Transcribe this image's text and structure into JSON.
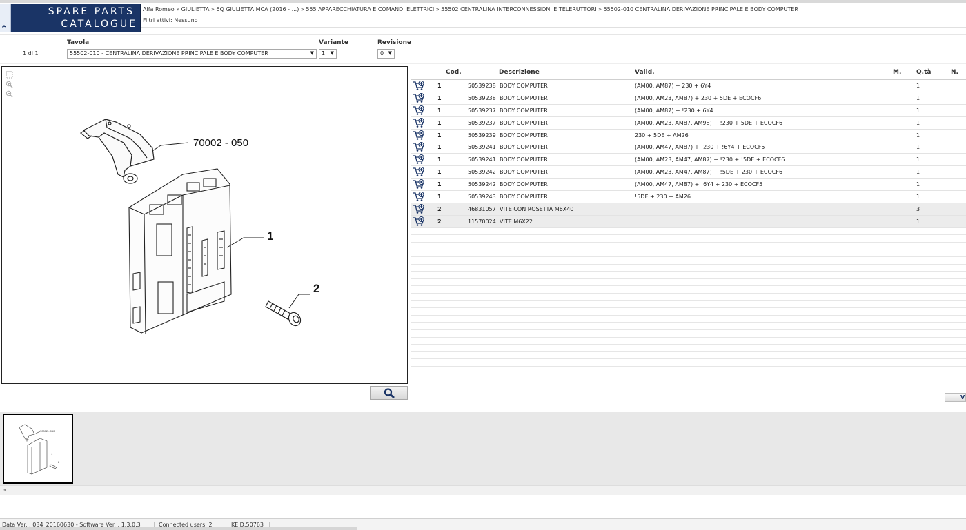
{
  "logo": {
    "badge": "e",
    "line1": "SPARE PARTS",
    "line2": "CATALOGUE"
  },
  "breadcrumb": "Alfa Romeo » GIULIETTA » 6Q GIULIETTA MCA (2016 - ...) » 555 APPARECCHIATURA E COMANDI ELETTRICI » 55502 CENTRALINA INTERCONNESSIONI E TELERUTTORI » 55502-010 CENTRALINA DERIVAZIONE PRINCIPALE E BODY COMPUTER",
  "filters": "Filtri attivi: Nessuno",
  "selectors": {
    "pager": "1 di 1",
    "tavola_label": "Tavola",
    "tavola_value": "55502-010 - CENTRALINA DERIVAZIONE PRINCIPALE E BODY COMPUTER",
    "variante_label": "Variante",
    "variante_value": "1",
    "revisione_label": "Revisione",
    "revisione_value": "0"
  },
  "drawing": {
    "callout_bracket": "70002 - 050",
    "callout_1": "1",
    "callout_2": "2",
    "tools": [
      "select-icon",
      "zoom-in-icon",
      "zoom-out-icon"
    ]
  },
  "table": {
    "headers": {
      "cod": "Cod.",
      "descrizione": "Descrizione",
      "valid": "Valid.",
      "m": "M.",
      "qta": "Q.tà",
      "n": "N."
    },
    "rows": [
      {
        "ref": "1",
        "cod": "50539238",
        "desc": "BODY COMPUTER",
        "valid": "(AM00, AM87) + 230 + 6Y4",
        "m": "",
        "qta": "1",
        "n": ""
      },
      {
        "ref": "1",
        "cod": "50539238",
        "desc": "BODY COMPUTER",
        "valid": "(AM00, AM23, AM87) + 230 + 5DE + ECOCF6",
        "m": "",
        "qta": "1",
        "n": ""
      },
      {
        "ref": "1",
        "cod": "50539237",
        "desc": "BODY COMPUTER",
        "valid": "(AM00, AM87) + !230 + 6Y4",
        "m": "",
        "qta": "1",
        "n": ""
      },
      {
        "ref": "1",
        "cod": "50539237",
        "desc": "BODY COMPUTER",
        "valid": "(AM00, AM23, AM87, AM98) + !230 + 5DE + ECOCF6",
        "m": "",
        "qta": "1",
        "n": ""
      },
      {
        "ref": "1",
        "cod": "50539239",
        "desc": "BODY COMPUTER",
        "valid": "230 + 5DE + AM26",
        "m": "",
        "qta": "1",
        "n": ""
      },
      {
        "ref": "1",
        "cod": "50539241",
        "desc": "BODY COMPUTER",
        "valid": "(AM00, AM47, AM87) + !230 + !6Y4 + ECOCF5",
        "m": "",
        "qta": "1",
        "n": ""
      },
      {
        "ref": "1",
        "cod": "50539241",
        "desc": "BODY COMPUTER",
        "valid": "(AM00, AM23, AM47, AM87) + !230 + !5DE + ECOCF6",
        "m": "",
        "qta": "1",
        "n": ""
      },
      {
        "ref": "1",
        "cod": "50539242",
        "desc": "BODY COMPUTER",
        "valid": "(AM00, AM23, AM47, AM87) + !5DE + 230 + ECOCF6",
        "m": "",
        "qta": "1",
        "n": ""
      },
      {
        "ref": "1",
        "cod": "50539242",
        "desc": "BODY COMPUTER",
        "valid": "(AM00, AM47, AM87) + !6Y4 + 230 + ECOCF5",
        "m": "",
        "qta": "1",
        "n": ""
      },
      {
        "ref": "1",
        "cod": "50539243",
        "desc": "BODY COMPUTER",
        "valid": "!5DE + 230 + AM26",
        "m": "",
        "qta": "1",
        "n": ""
      },
      {
        "ref": "2",
        "cod": "46831057",
        "desc": "VITE CON ROSETTA M6X40",
        "valid": "",
        "m": "",
        "qta": "3",
        "n": ""
      },
      {
        "ref": "2",
        "cod": "11570024",
        "desc": "VITE M6X22",
        "valid": "",
        "m": "",
        "qta": "1",
        "n": ""
      }
    ]
  },
  "side_button": "V",
  "status": {
    "data_ver": "Data Ver. : 034_20160630 - Software Ver. : 1.3.0.3",
    "users": "Connected users: 2",
    "keid": "KEID:50763"
  },
  "colors": {
    "brand": "#1a3466",
    "alt_row": "#ececec",
    "thumb_strip": "#e8e8e8"
  }
}
